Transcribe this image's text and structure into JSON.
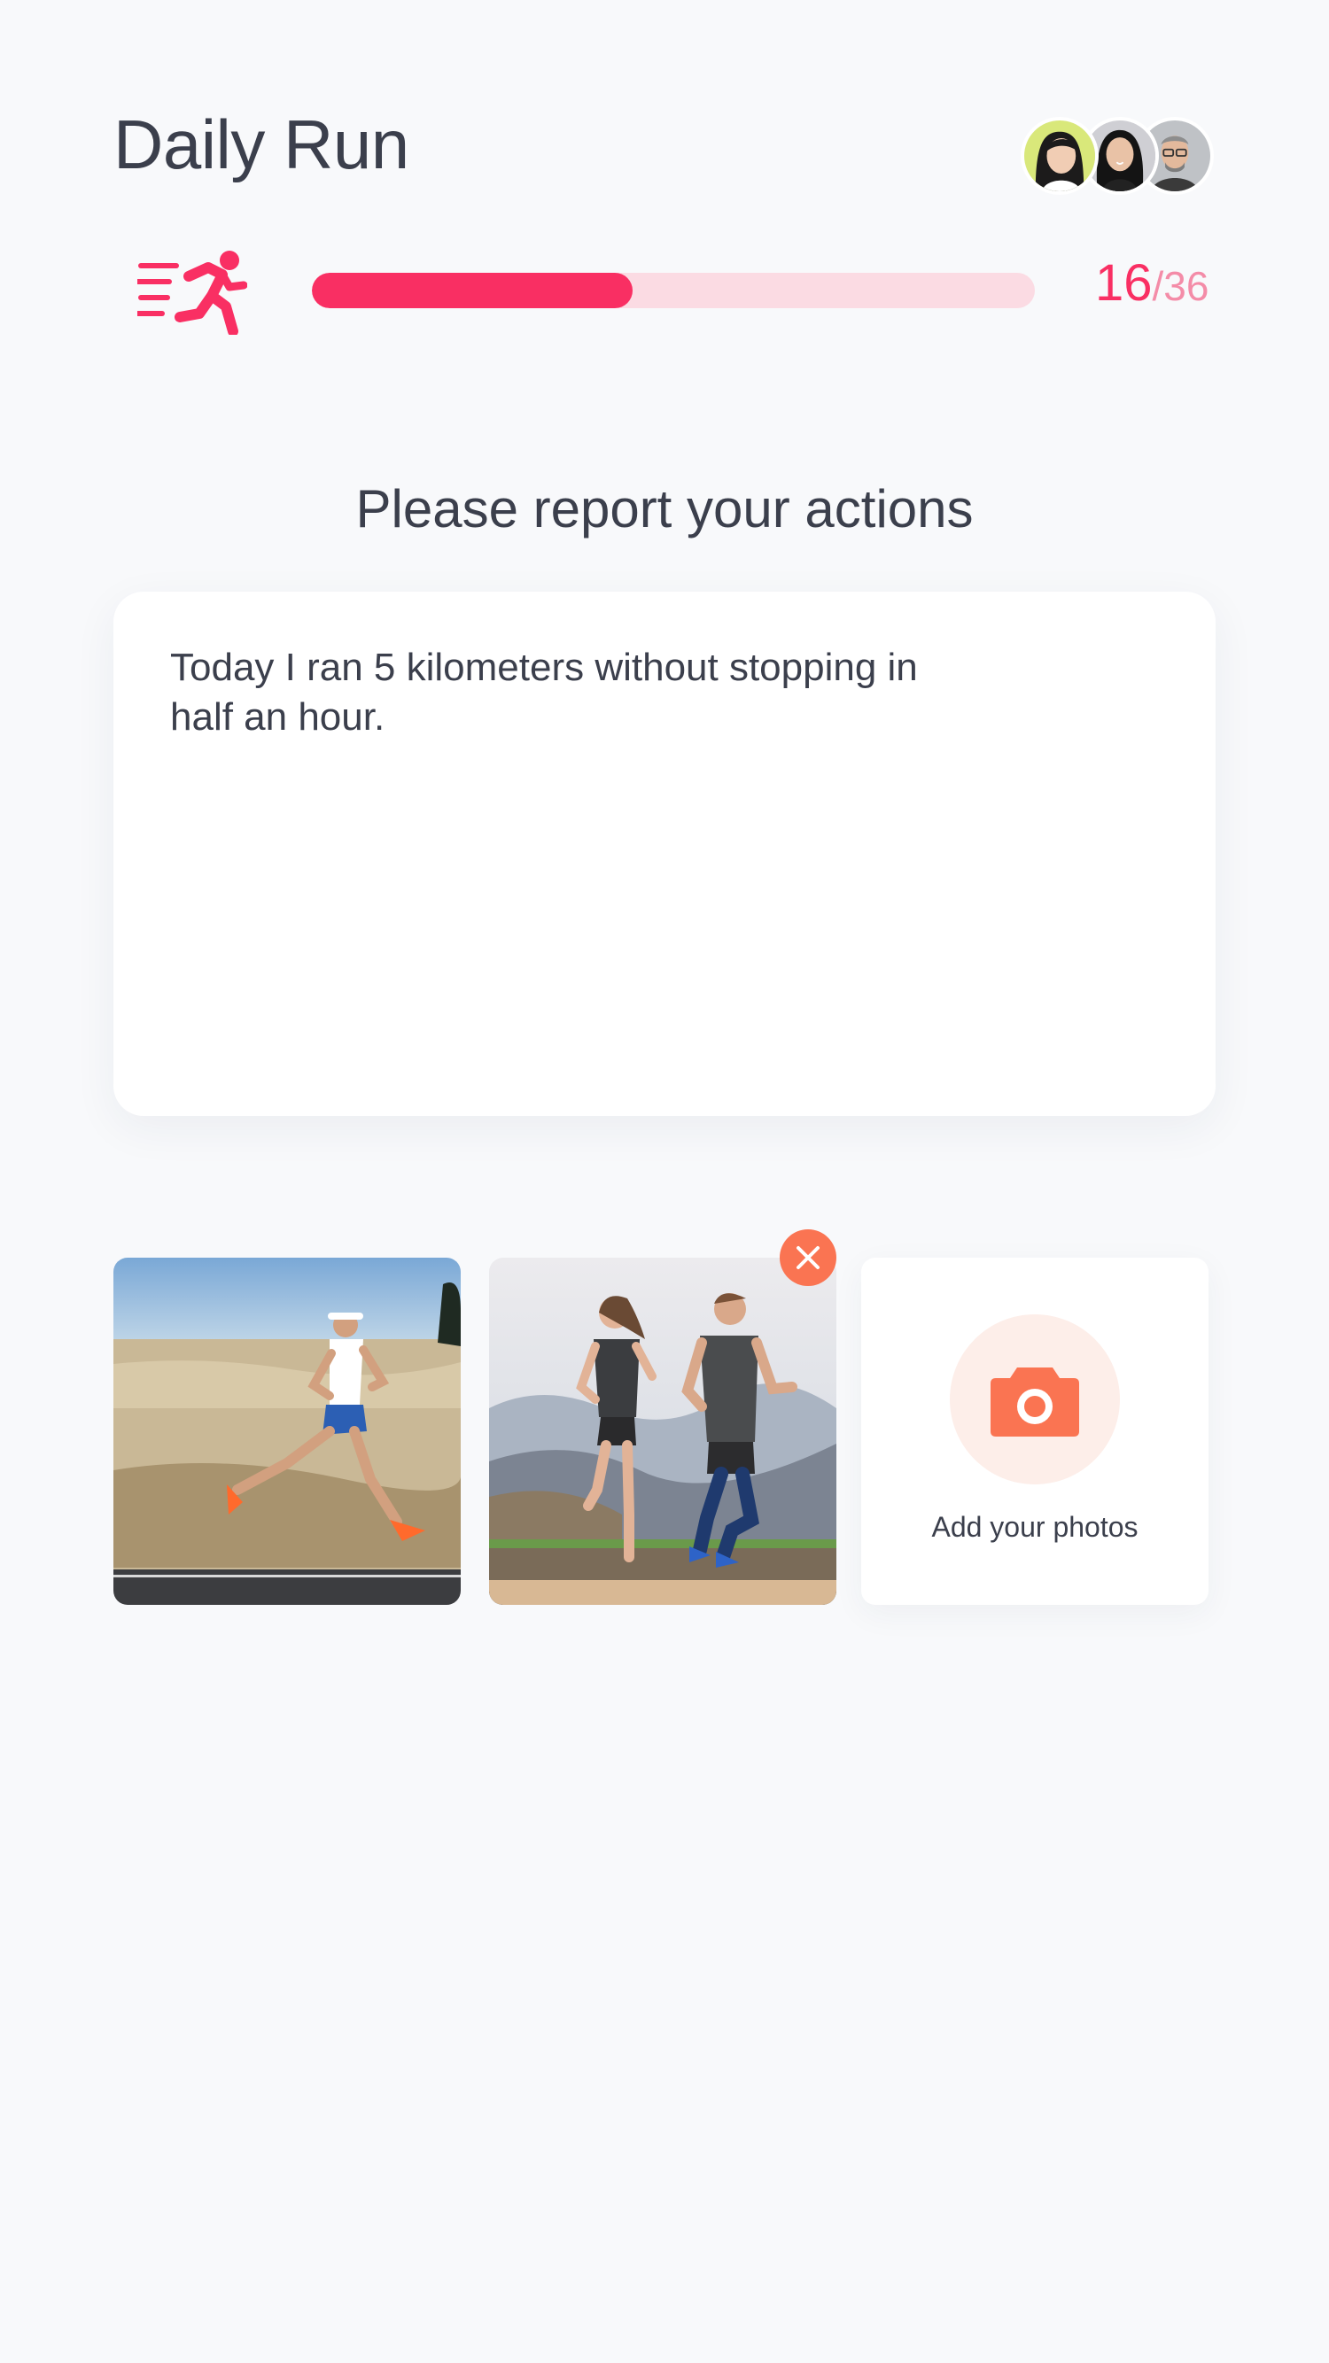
{
  "header": {
    "title": "Daily Run",
    "participants": [
      {
        "name": "avatar-woman-1",
        "bg": "#d9e87a"
      },
      {
        "name": "avatar-woman-2",
        "bg": "#cfcfd4"
      },
      {
        "name": "avatar-man",
        "bg": "#bfc2c6"
      }
    ]
  },
  "progress": {
    "icon": "runner-icon",
    "current": "16",
    "separator": "/",
    "total": "36",
    "fraction": 0.444,
    "fill_color": "#f92f63",
    "track_color": "#fbdbe3"
  },
  "report": {
    "prompt": "Please report your actions",
    "text": "Today I ran 5 kilometers without stopping in half an hour."
  },
  "photos": {
    "items": [
      {
        "name": "photo-solo-runner"
      },
      {
        "name": "photo-couple-running",
        "removable": true
      }
    ],
    "remove_icon": "close-icon",
    "add_label": "Add your photos",
    "add_icon": "camera-icon",
    "accent": "#fa7452"
  }
}
